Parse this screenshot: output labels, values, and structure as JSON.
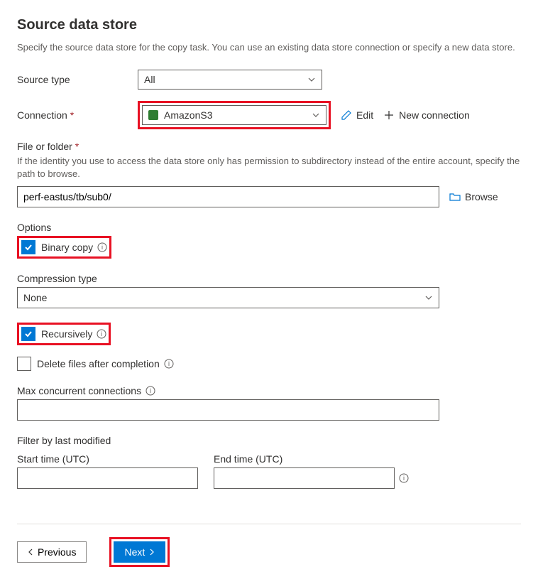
{
  "header": {
    "title": "Source data store",
    "subtitle": "Specify the source data store for the copy task. You can use an existing data store connection or specify a new data store."
  },
  "sourceType": {
    "label": "Source type",
    "value": "All"
  },
  "connection": {
    "label": "Connection",
    "value": "AmazonS3",
    "editLabel": "Edit",
    "newLabel": "New connection"
  },
  "fileOrFolder": {
    "label": "File or folder",
    "helper": "If the identity you use to access the data store only has permission to subdirectory instead of the entire account, specify the path to browse.",
    "value": "perf-eastus/tb/sub0/",
    "browseLabel": "Browse"
  },
  "options": {
    "label": "Options",
    "binaryCopy": {
      "label": "Binary copy",
      "checked": true
    },
    "compression": {
      "label": "Compression type",
      "value": "None"
    },
    "recursively": {
      "label": "Recursively",
      "checked": true
    },
    "deleteAfter": {
      "label": "Delete files after completion",
      "checked": false
    }
  },
  "maxConcurrent": {
    "label": "Max concurrent connections",
    "value": ""
  },
  "filter": {
    "label": "Filter by last modified",
    "startLabel": "Start time (UTC)",
    "endLabel": "End time (UTC)",
    "startValue": "",
    "endValue": ""
  },
  "footer": {
    "previous": "Previous",
    "next": "Next"
  }
}
